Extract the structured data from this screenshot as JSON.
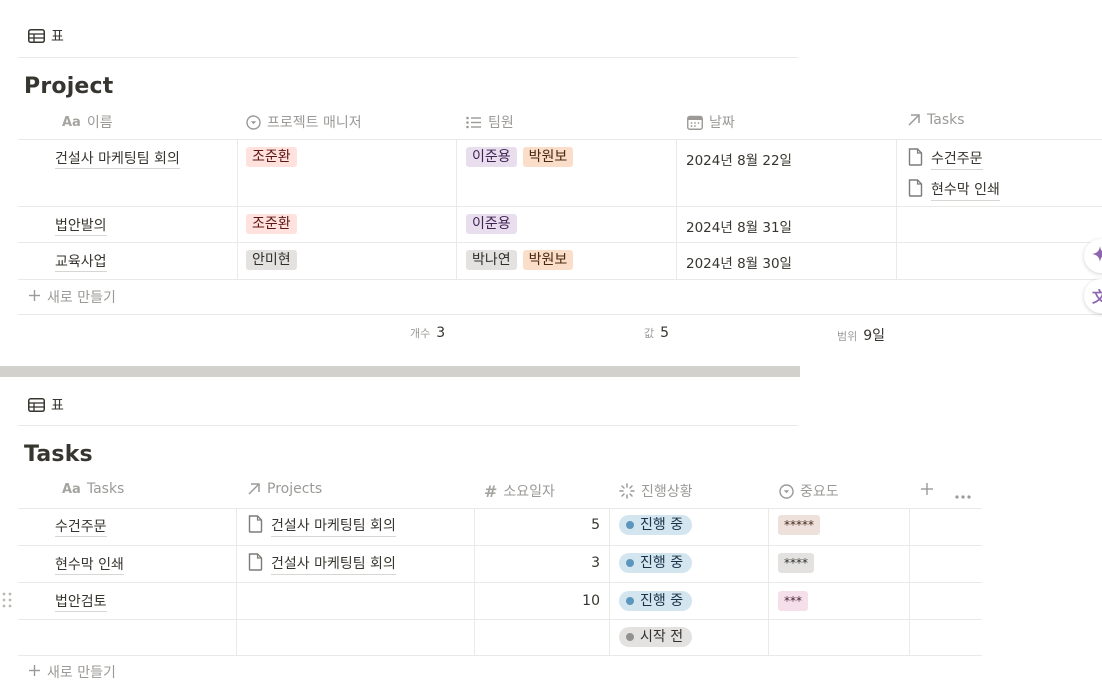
{
  "project_db": {
    "view_tab": "표",
    "title": "Project",
    "columns": {
      "name": "이름",
      "name_prefix": "Aa",
      "manager": "프로젝트 매니저",
      "members": "팀원",
      "date": "날짜",
      "tasks": "Tasks"
    },
    "rows": [
      {
        "name": "건설사 마케팅팀 회의",
        "manager": "조준환",
        "members": [
          "이준용",
          "박원보"
        ],
        "date": "2024년 8월 22일",
        "tasks": [
          "수건주문",
          "현수막 인쇄"
        ]
      },
      {
        "name": "법안발의",
        "manager": "조준환",
        "members": [
          "이준용"
        ],
        "date": "2024년 8월 31일",
        "tasks": []
      },
      {
        "name": "교육사업",
        "manager": "안미현",
        "members": [
          "박나연",
          "박원보"
        ],
        "date": "2024년 8월 30일",
        "tasks": []
      }
    ],
    "new_row": "새로 만들기",
    "calcs": {
      "count_label": "개수",
      "count_value": "3",
      "values_label": "값",
      "values_value": "5",
      "range_label": "범위",
      "range_value": "9일"
    }
  },
  "tasks_db": {
    "view_tab": "표",
    "title": "Tasks",
    "columns": {
      "name": "Tasks",
      "name_prefix": "Aa",
      "projects": "Projects",
      "days": "소요일자",
      "status": "진행상황",
      "priority": "중요도"
    },
    "rows": [
      {
        "name": "수건주문",
        "project": "건설사 마케팅팀 회의",
        "days": "5",
        "status": "진행 중",
        "priority": "*****"
      },
      {
        "name": "현수막 인쇄",
        "project": "건설사 마케팅팀 회의",
        "days": "3",
        "status": "진행 중",
        "priority": "****"
      },
      {
        "name": "법안검토",
        "project": "",
        "days": "10",
        "status": "진행 중",
        "priority": "***"
      },
      {
        "name": "",
        "project": "",
        "days": "",
        "status": "시작 전",
        "priority": ""
      }
    ],
    "new_row": "새로 만들기"
  },
  "colors": {
    "status_in_progress": "#d3e5ef",
    "status_not_started": "#e3e2e0",
    "ai_accent": "#9065b0"
  }
}
